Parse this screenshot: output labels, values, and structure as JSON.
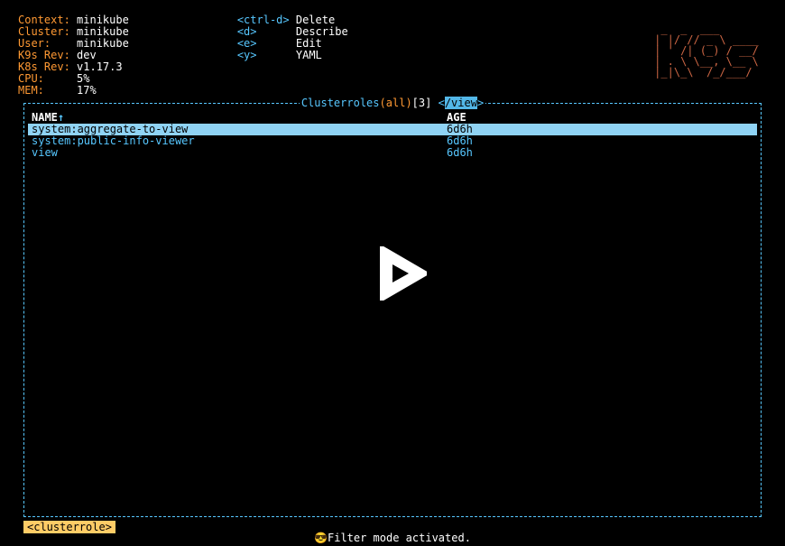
{
  "header": {
    "context": {
      "label": "Context:",
      "value": "minikube"
    },
    "cluster": {
      "label": "Cluster:",
      "value": "minikube"
    },
    "user": {
      "label": "User:",
      "value": "minikube"
    },
    "k9s": {
      "label": "K9s Rev:",
      "value": "dev"
    },
    "k8s": {
      "label": "K8s Rev:",
      "value": "v1.17.3"
    },
    "cpu": {
      "label": "CPU:",
      "value": "5%"
    },
    "mem": {
      "label": "MEM:",
      "value": "17%"
    }
  },
  "shortcuts": [
    {
      "key": "<ctrl-d>",
      "desc": "Delete"
    },
    {
      "key": "<d>",
      "desc": "Describe"
    },
    {
      "key": "<e>",
      "desc": "Edit"
    },
    {
      "key": "<y>",
      "desc": "YAML"
    }
  ],
  "panel": {
    "title_resource": "Clusterroles",
    "title_scope": "all",
    "title_count": "[3]",
    "title_filter": "/view",
    "columns": {
      "name": "NAME",
      "sort_indicator": "↑",
      "age": "AGE"
    },
    "rows": [
      {
        "name": "system:aggregate-to-view",
        "age": "6d6h",
        "selected": true
      },
      {
        "name": "system:public-info-viewer",
        "age": "6d6h",
        "selected": false
      },
      {
        "name": "view",
        "age": "6d6h",
        "selected": false
      }
    ]
  },
  "crumb": "<clusterrole>",
  "status": "😎Filter mode activated.",
  "logo_lines": [
    " _  _  ___       ",
    "| |/ // _ \\ ____",
    "| ' /| (_) / __/",
    "| . \\ \\__, \\__ \\",
    "|_|\\_\\  /_/___/"
  ]
}
